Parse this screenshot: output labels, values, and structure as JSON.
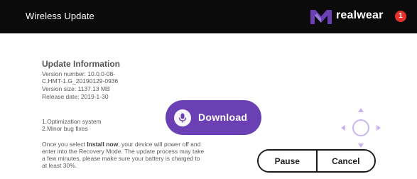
{
  "header": {
    "title": "Wireless Update",
    "brand": "realwear",
    "notification_count": "1"
  },
  "update_info": {
    "title": "Update Information",
    "version_label": "Version number: 10.0.0-08-",
    "version_label_cont": "C.HMT-1.G_20190129-0936",
    "size": "Version size: 1137.13 MB",
    "release_date": "Release date: 2019-1-30",
    "changes": [
      "1.Optimization system",
      "2.Minor bug fixes"
    ],
    "note_prefix": "Once you select ",
    "note_emphasis": "Install now",
    "note_suffix": ", your device will power off and enter into the Recovery Mode. The update process may take a few minutes, please make sure your battery is charged to at least 30%."
  },
  "actions": {
    "download_label": "Download",
    "pause_label": "Pause",
    "cancel_label": "Cancel"
  },
  "colors": {
    "accent": "#6b40b4",
    "topbar": "#0b0b0b",
    "badge": "#e5322d",
    "dpad": "#c9b6ec"
  },
  "icons": {
    "brand_logo": "realwear-logo-icon",
    "download": "microphone-icon",
    "navigation": "dpad-icon"
  }
}
